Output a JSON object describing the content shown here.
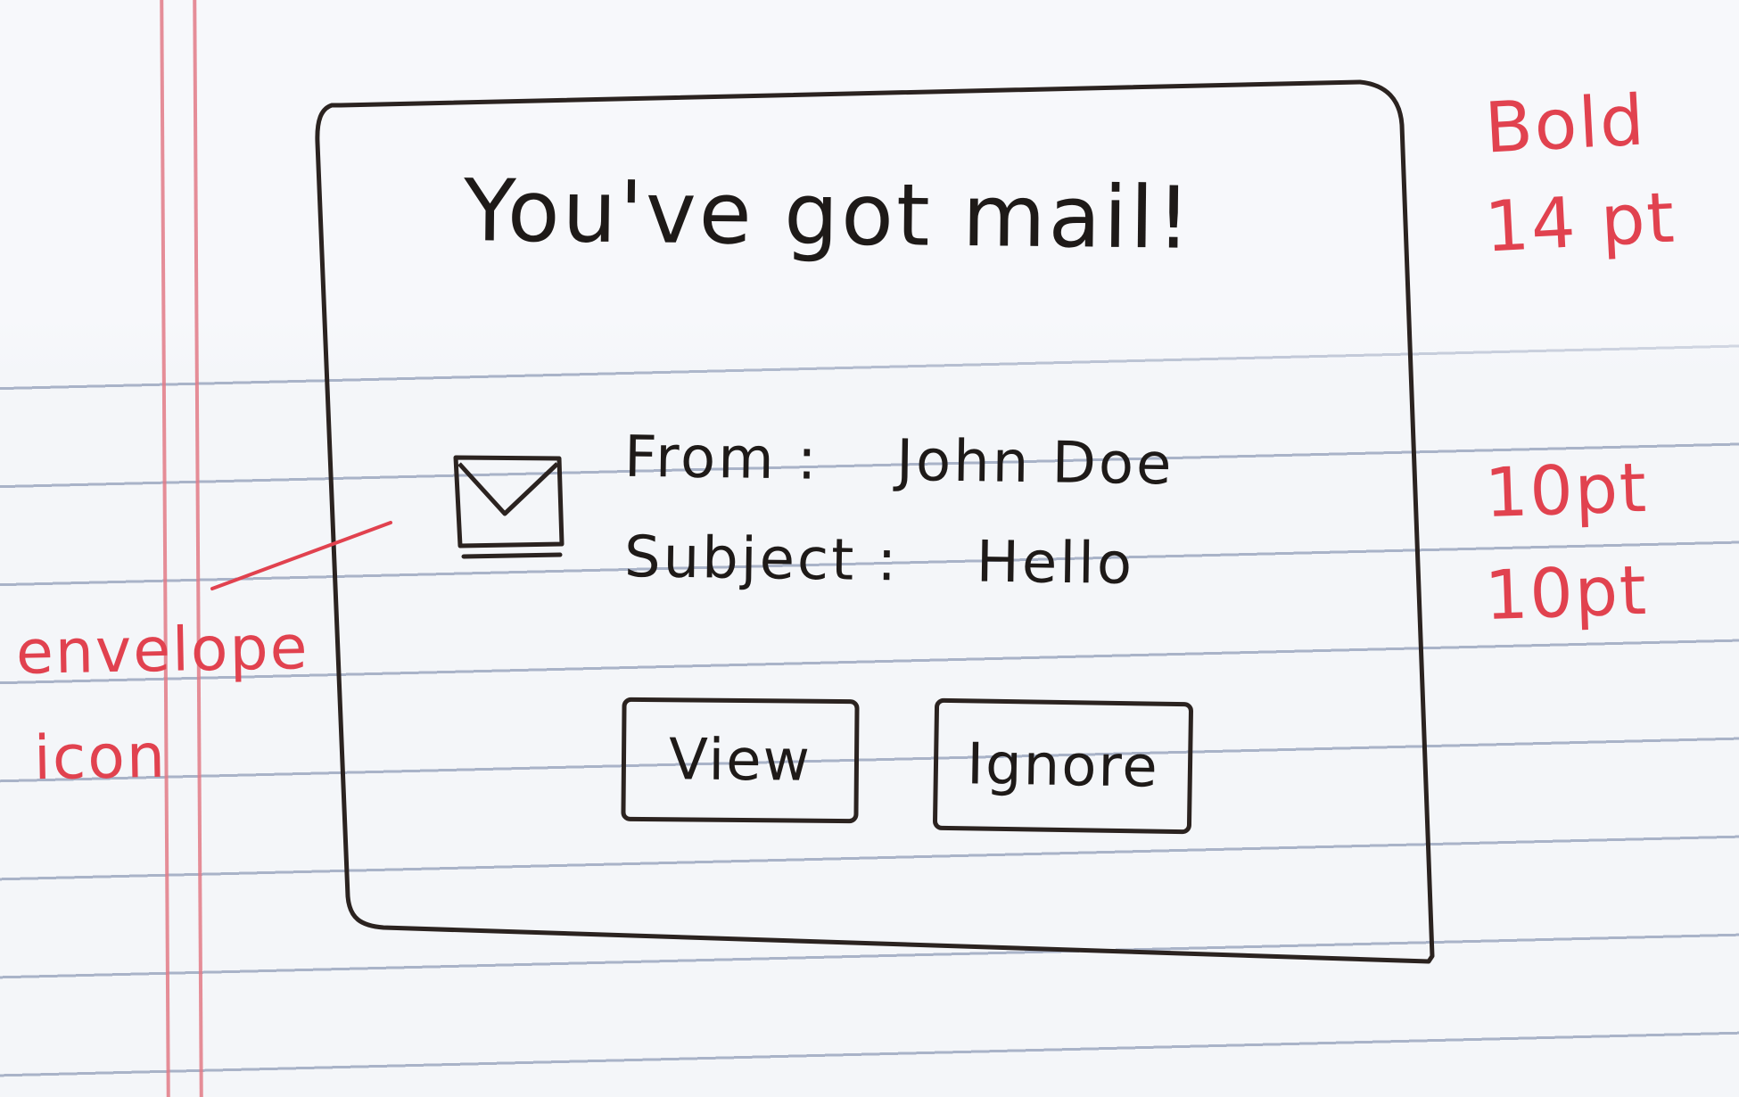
{
  "dialog": {
    "title": "You've got mail!",
    "from_label": "From",
    "from_value": "John Doe",
    "subject_label": "Subject",
    "subject_value": "Hello",
    "separator": ":",
    "view_button": "View",
    "ignore_button": "Ignore",
    "icon": "envelope-icon"
  },
  "annotations": {
    "title_style_line1": "Bold",
    "title_style_line2": "14 pt",
    "from_size": "10pt",
    "subject_size": "10pt",
    "icon_note_line1": "envelope",
    "icon_note_line2": "icon"
  },
  "colors": {
    "ink": "#2b2320",
    "annotation": "#e1424f",
    "paper": "#f4f6f9",
    "rule_line": "#a9b3c8",
    "margin_line": "#e27a86"
  }
}
